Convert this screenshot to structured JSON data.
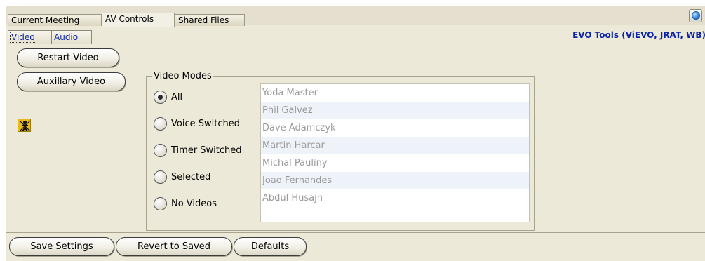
{
  "tabs": [
    "Current Meeting",
    "AV Controls",
    "Shared Files"
  ],
  "active_tab": "AV Controls",
  "subtabs": [
    "Video",
    "Audio"
  ],
  "active_subtab": "Video",
  "tools_label": "EVO Tools (ViEVO, JRAT, WB)",
  "buttons": {
    "restart_video": "Restart Video",
    "auxiliary_video": "Auxillary Video",
    "save_settings": "Save Settings",
    "revert_to_saved": "Revert to Saved",
    "defaults": "Defaults"
  },
  "video_modes": {
    "legend": "Video Modes",
    "options": [
      "All",
      "Voice Switched",
      "Timer Switched",
      "Selected",
      "No Videos"
    ],
    "selected": "All"
  },
  "participants": [
    "Yoda Master",
    "Phil Galvez",
    "Dave Adamczyk",
    "Martin Harcar",
    "Michal Pauliny",
    "Joao Fernandes",
    "Abdul Husajn"
  ],
  "icons": {
    "globe": "globe-icon",
    "no_video": "no-video-icon"
  },
  "colors": {
    "link_blue": "#0b23a8",
    "panel_bg": "#ece9d8",
    "icon_yellow": "#e8b91a"
  }
}
